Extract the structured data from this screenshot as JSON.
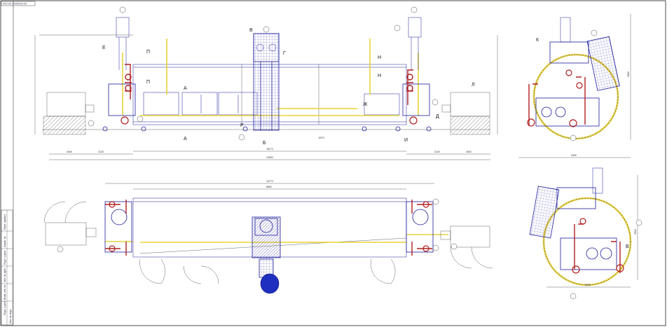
{
  "sheet": {
    "title_stamp": "ХХХ.ХХ.ХХХХХХХ.ХХ",
    "side_stamp_lines": [
      "Перв. примен.",
      "Справ. №",
      "Подп. и дата",
      "Инв. № дубл.",
      "Взам. инв. №",
      "Подп. и дата",
      "Инв. № подл."
    ]
  },
  "callouts": {
    "E": "Е",
    "P1": "П",
    "P2": "П",
    "A1": "А",
    "A2": "А",
    "R": "Р",
    "B": "Б",
    "V": "В",
    "G": "Г",
    "D": "Д",
    "ZH": "Ж",
    "I": "И",
    "N1": "Н",
    "N2": "Н",
    "L": "Л",
    "K": "К",
    "V2": "В"
  },
  "dims": {
    "top_total": "22800",
    "top_span": "18170",
    "top_left": "4500",
    "top_left2": "3100",
    "top_right": "3100",
    "top_right2": "4500",
    "top_mid": "8970",
    "plan_total": "15770",
    "plan_inner": "8860",
    "side_w": "5400",
    "side_h": "9850",
    "side2_w": "5400",
    "side2_h": "4500"
  },
  "colors": {
    "line": "#1c1c9c",
    "pipe_yellow": "#e8d23a",
    "flange_red": "#b01e1e",
    "hatch": "#8a8a8a",
    "fill_blue": "#1f2fbf"
  }
}
